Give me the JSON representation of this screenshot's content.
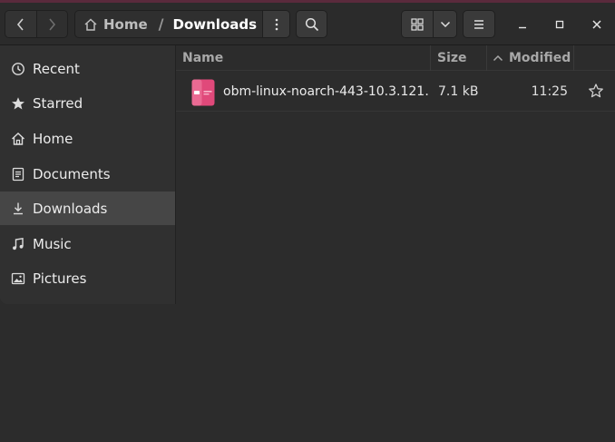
{
  "toolbar": {
    "back_icon": "chevron-left-icon",
    "forward_icon": "chevron-right-icon",
    "more_icon": "vertical-dots-icon",
    "search_icon": "search-icon",
    "view_icon": "grid-view-icon",
    "view_dropdown_icon": "chevron-down-icon",
    "menu_icon": "hamburger-icon"
  },
  "breadcrumb": {
    "home_label": "Home",
    "separator": "/",
    "current_label": "Downloads"
  },
  "window_controls": {
    "minimize_icon": "minimize-icon",
    "maximize_icon": "maximize-icon",
    "close_icon": "close-icon"
  },
  "sidebar": {
    "items": [
      {
        "label": "Recent",
        "icon": "clock-icon",
        "active": false
      },
      {
        "label": "Starred",
        "icon": "star-icon",
        "active": false
      },
      {
        "label": "Home",
        "icon": "home-icon",
        "active": false
      },
      {
        "label": "Documents",
        "icon": "document-icon",
        "active": false
      },
      {
        "label": "Downloads",
        "icon": "download-icon",
        "active": true
      },
      {
        "label": "Music",
        "icon": "music-icon",
        "active": false
      },
      {
        "label": "Pictures",
        "icon": "picture-icon",
        "active": false
      }
    ]
  },
  "columns": {
    "name": "Name",
    "size": "Size",
    "modified": "Modified",
    "modified_sort": "ascending"
  },
  "files": [
    {
      "name": "obm-linux-noarch-443-10.3.121…",
      "size": "7.1 kB",
      "modified": "11:25",
      "icon": "package-icon",
      "starred": false
    }
  ],
  "colors": {
    "accent_pink": "#e0497a",
    "sidebar_active": "#464646",
    "background": "#2c2c2c"
  }
}
